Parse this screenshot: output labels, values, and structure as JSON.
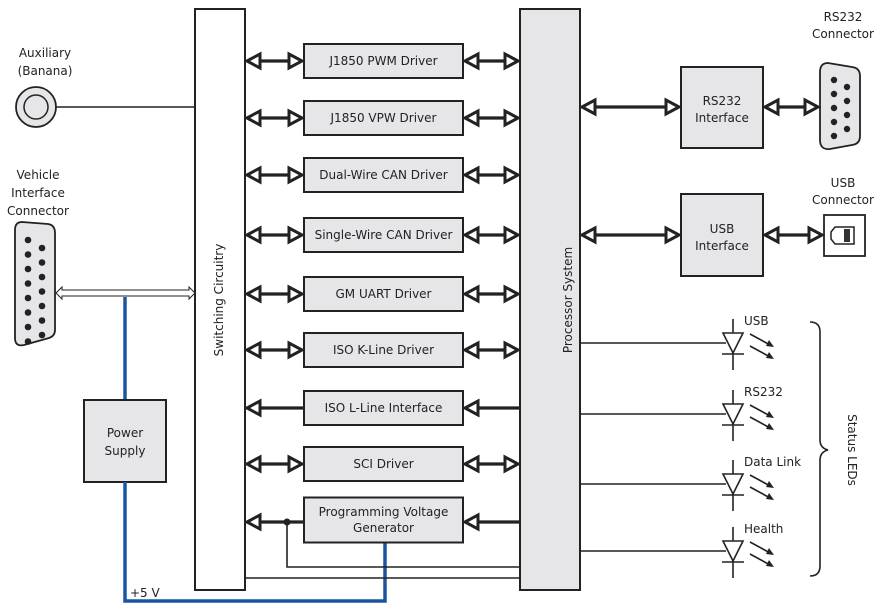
{
  "colors": {
    "block_fill": "#e6e6e8",
    "power_line": "#1a56a0",
    "line": "#222222"
  },
  "connectors": {
    "auxiliary": [
      "Auxiliary",
      "(Banana)"
    ],
    "vehicle": [
      "Vehicle",
      "Interface",
      "Connector"
    ],
    "rs232": [
      "RS232",
      "Connector"
    ],
    "usb": [
      "USB",
      "Connector"
    ]
  },
  "switching": "Switching Circuitry",
  "processor": "Processor System",
  "power_supply": [
    "Power",
    "Supply"
  ],
  "plus5v": "+5 V",
  "drivers": [
    {
      "label": [
        "J1850 PWM Driver"
      ],
      "direction": "bidirectional"
    },
    {
      "label": [
        "J1850 VPW Driver"
      ],
      "direction": "bidirectional"
    },
    {
      "label": [
        "Dual-Wire CAN Driver"
      ],
      "direction": "bidirectional"
    },
    {
      "label": [
        "Single-Wire CAN Driver"
      ],
      "direction": "bidirectional"
    },
    {
      "label": [
        "GM UART Driver"
      ],
      "direction": "bidirectional"
    },
    {
      "label": [
        "ISO K-Line Driver"
      ],
      "direction": "bidirectional"
    },
    {
      "label": [
        "ISO L-Line Interface"
      ],
      "direction": "left"
    },
    {
      "label": [
        "SCI Driver"
      ],
      "direction": "bidirectional"
    },
    {
      "label": [
        "Programming Voltage",
        "Generator"
      ],
      "direction": "left"
    }
  ],
  "interfaces": {
    "rs232": [
      "RS232",
      "Interface"
    ],
    "usb": [
      "USB",
      "Interface"
    ]
  },
  "leds": {
    "group_label": "Status LEDs",
    "items": [
      "USB",
      "RS232",
      "Data Link",
      "Health"
    ]
  }
}
